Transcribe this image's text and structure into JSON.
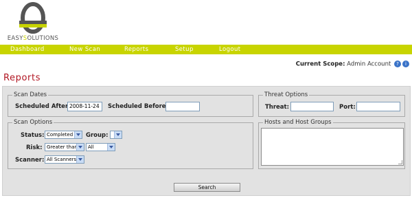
{
  "brand": {
    "name_prefix": "EASY",
    "name_hl": "S",
    "name_suffix": "OLUTIONS"
  },
  "nav": {
    "items": [
      "Dashboard",
      "New Scan",
      "Reports",
      "Setup",
      "Logout"
    ]
  },
  "scope": {
    "label": "Current Scope:",
    "value": "Admin Account"
  },
  "page_title": "Reports",
  "scan_dates": {
    "legend": "Scan Dates",
    "after_label": "Scheduled After:",
    "after_value": "2008-11-24",
    "before_label": "Scheduled Before:",
    "before_value": ""
  },
  "threat_options": {
    "legend": "Threat Options",
    "threat_label": "Threat:",
    "threat_value": "",
    "port_label": "Port:",
    "port_value": ""
  },
  "scan_options": {
    "legend": "Scan Options",
    "status_label": "Status:",
    "status_value": "Completed",
    "group_label": "Group:",
    "group_value": "",
    "risk_label": "Risk:",
    "risk_operator": "Greater than",
    "risk_value": "All",
    "scanner_label": "Scanner:",
    "scanner_value": "All Scanners"
  },
  "hosts": {
    "legend": "Hosts and Host Groups",
    "value": ""
  },
  "search_button": "Search",
  "colors": {
    "nav_bar": "#c8d400",
    "title": "#b11622",
    "panel": "#e2e2e2"
  },
  "icons": [
    "help-icon",
    "info-icon"
  ]
}
